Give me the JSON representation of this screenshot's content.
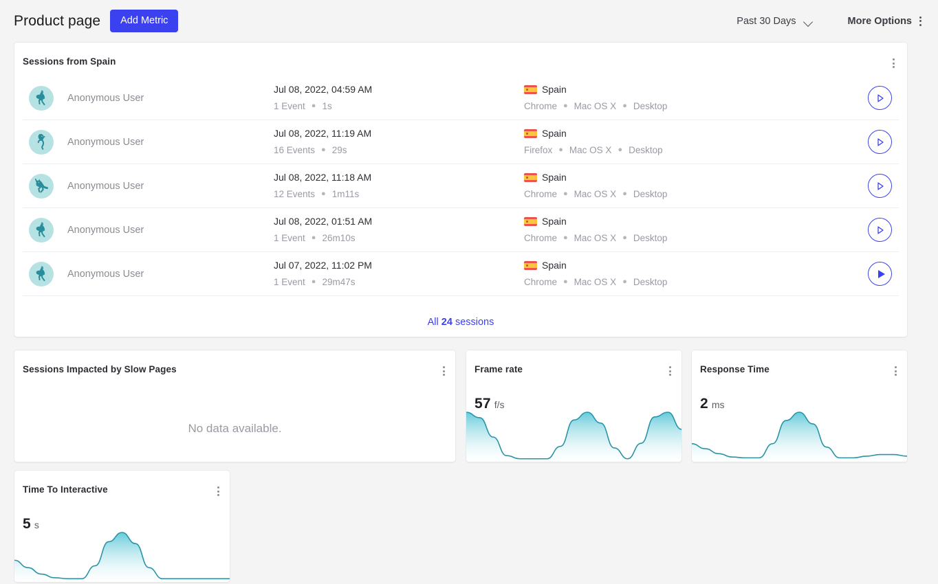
{
  "header": {
    "title": "Product page",
    "add_metric_label": "Add Metric",
    "date_range": "Past 30 Days",
    "more_options_label": "More Options",
    "accent_color": "#3b41ef"
  },
  "sessions_card": {
    "title": "Sessions from Spain",
    "footer_prefix": "All ",
    "footer_count": "24",
    "footer_suffix": " sessions",
    "rows": [
      {
        "avatar": "kangaroo-icon",
        "user": "Anonymous User",
        "time": "Jul 08, 2022, 04:59 AM",
        "events": "1 Event",
        "duration": "1s",
        "country": "Spain",
        "browser": "Chrome",
        "os": "Mac OS X",
        "device": "Desktop",
        "play_state": "outline"
      },
      {
        "avatar": "seahorse-icon",
        "user": "Anonymous User",
        "time": "Jul 08, 2022, 11:19 AM",
        "events": "16 Events",
        "duration": "29s",
        "country": "Spain",
        "browser": "Firefox",
        "os": "Mac OS X",
        "device": "Desktop",
        "play_state": "outline"
      },
      {
        "avatar": "horse-icon",
        "user": "Anonymous User",
        "time": "Jul 08, 2022, 11:18 AM",
        "events": "12 Events",
        "duration": "1m11s",
        "country": "Spain",
        "browser": "Chrome",
        "os": "Mac OS X",
        "device": "Desktop",
        "play_state": "outline"
      },
      {
        "avatar": "kangaroo-icon",
        "user": "Anonymous User",
        "time": "Jul 08, 2022, 01:51 AM",
        "events": "1 Event",
        "duration": "26m10s",
        "country": "Spain",
        "browser": "Chrome",
        "os": "Mac OS X",
        "device": "Desktop",
        "play_state": "outline"
      },
      {
        "avatar": "kangaroo-icon",
        "user": "Anonymous User",
        "time": "Jul 07, 2022, 11:02 PM",
        "events": "1 Event",
        "duration": "29m47s",
        "country": "Spain",
        "browser": "Chrome",
        "os": "Mac OS X",
        "device": "Desktop",
        "play_state": "filled"
      }
    ]
  },
  "metrics": [
    {
      "title": "Sessions Impacted by Slow Pages",
      "empty_text": "No data available.",
      "value": null,
      "unit": null
    },
    {
      "title": "Frame rate",
      "value": "57",
      "unit": "f/s"
    },
    {
      "title": "Response Time",
      "value": "2",
      "unit": "ms"
    },
    {
      "title": "Time To Interactive",
      "value": "5",
      "unit": "s"
    }
  ],
  "chart_data": [
    {
      "type": "area",
      "title": "Frame rate",
      "ylabel": "f/s",
      "current_value": 57,
      "x": [
        0,
        1,
        2,
        3,
        4,
        5,
        6,
        7,
        8,
        9,
        10,
        11,
        12,
        13,
        14,
        15,
        16
      ],
      "values": [
        62,
        55,
        30,
        6,
        2,
        2,
        2,
        18,
        52,
        62,
        48,
        16,
        2,
        22,
        56,
        62,
        40
      ],
      "line_color": "#2a93a8",
      "fill_gradient": [
        "#5ec8d8",
        "#ffffff"
      ],
      "grid": false,
      "legend": "none"
    },
    {
      "type": "area",
      "title": "Response Time",
      "ylabel": "ms",
      "current_value": 2,
      "x": [
        0,
        1,
        2,
        3,
        4,
        5,
        6,
        7,
        8,
        9,
        10,
        11,
        12,
        13,
        14,
        15,
        16
      ],
      "values": [
        20,
        14,
        8,
        4,
        3,
        3,
        20,
        48,
        58,
        44,
        16,
        3,
        3,
        5,
        7,
        7,
        5
      ],
      "line_color": "#2a93a8",
      "fill_gradient": [
        "#5ec8d8",
        "#ffffff"
      ],
      "grid": false,
      "legend": "none"
    },
    {
      "type": "area",
      "title": "Time To Interactive",
      "ylabel": "s",
      "current_value": 5,
      "x": [
        0,
        1,
        2,
        3,
        4,
        5,
        6,
        7,
        8,
        9,
        10,
        11,
        12,
        13,
        14,
        15,
        16
      ],
      "values": [
        22,
        14,
        7,
        3,
        2,
        2,
        16,
        42,
        52,
        40,
        14,
        2,
        2,
        2,
        2,
        2,
        2
      ],
      "line_color": "#2a93a8",
      "fill_gradient": [
        "#5ec8d8",
        "#ffffff"
      ],
      "grid": false,
      "legend": "none"
    },
    {
      "type": "area",
      "title": "Sessions Impacted by Slow Pages",
      "values": [],
      "note": "No data available."
    }
  ]
}
